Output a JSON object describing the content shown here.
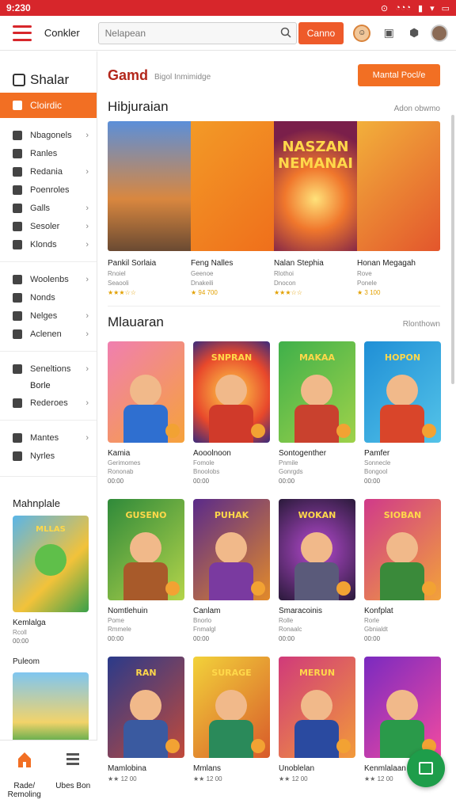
{
  "status": {
    "time": "9:230"
  },
  "appbar": {
    "brand": "Conkler",
    "search_placeholder": "Nelapean",
    "search_button": "Canno"
  },
  "sidebar": {
    "title": "Shalar",
    "active": "Cloirdic",
    "items": [
      {
        "label": "Nbagonels",
        "chevron": true
      },
      {
        "label": "Ranles",
        "chevron": false
      },
      {
        "label": "Redania",
        "chevron": true
      },
      {
        "label": "Poenroles",
        "chevron": false
      },
      {
        "label": "Galls",
        "chevron": true
      },
      {
        "label": "Sesoler",
        "chevron": true
      },
      {
        "label": "Klonds",
        "chevron": true
      }
    ],
    "items2": [
      {
        "label": "Woolenbs",
        "chevron": true
      },
      {
        "label": "Nonds",
        "chevron": false
      },
      {
        "label": "Nelges",
        "chevron": true
      },
      {
        "label": "Aclenen",
        "chevron": true
      }
    ],
    "items3": [
      {
        "label": "Seneltions",
        "chevron": true,
        "sub": "Borle"
      },
      {
        "label": "Rederoes",
        "chevron": true
      }
    ],
    "items4": [
      {
        "label": "Mantes",
        "chevron": true
      },
      {
        "label": "Nyrles",
        "chevron": false
      }
    ],
    "featured_title": "Mahnplale",
    "featured_card": {
      "title": "Kemlalga",
      "sub": "Rcoll",
      "meta": "00:00"
    },
    "featured2_title": "Puleom"
  },
  "bottomnav": [
    {
      "label": "Rade/ Remoling",
      "icon": "home-icon"
    },
    {
      "label": "Ubes Bon",
      "icon": "list-icon"
    }
  ],
  "main": {
    "title": "Gamd",
    "subtitle": "Bigol Inmimidge",
    "cta": "Mantal Pocl/e",
    "banner_section": {
      "title": "Hibjuraian",
      "more": "Adon obwmo"
    },
    "banner": [
      {
        "title": "Pankil Sorlaia",
        "sub": "Rnoiel",
        "meta": "Seaooli",
        "rating": "★★★☆☆",
        "bg": "linear-gradient(180deg,#5b8fd9 0%,#d9873f 60%,#6a4a32 100%)",
        "art": ""
      },
      {
        "title": "Feng Nalles",
        "sub": "Geenoe",
        "meta": "Dnakeili",
        "rating": "★ 94 700",
        "bg": "linear-gradient(135deg,#f39a27 0%,#ef6f1b 100%)",
        "art": ""
      },
      {
        "title": "Nalan Stephia",
        "sub": "Rlothoi",
        "meta": "Dnocon",
        "rating": "★★★☆☆",
        "bg": "radial-gradient(circle at 50% 60%,#ffe27a 0%,#f0772c 35%,#7a1f4a 80%)",
        "art": "NASZAN NEMANAI"
      },
      {
        "title": "Honan Megagah",
        "sub": "Rove",
        "meta": "Ponele",
        "rating": "★ 3 100",
        "bg": "linear-gradient(135deg,#f2b03b 0%,#e3562c 100%)",
        "art": ""
      }
    ],
    "grid_section": {
      "title": "Mlauaran",
      "more": "Rlonthown"
    },
    "rows": [
      [
        {
          "title": "Kamia",
          "sub": "Gerimomes",
          "meta": "Rononab",
          "stat": "00:00",
          "bg": "linear-gradient(135deg,#f07fb0,#f6a23a)",
          "art": "",
          "body": "#2f6fd0"
        },
        {
          "title": "Aooolnoon",
          "sub": "Fomole",
          "meta": "Bnoolobs",
          "stat": "00:00",
          "bg": "radial-gradient(circle at 50% 50%,#ffd24a,#e8482b 60%,#3a2b7c)",
          "art": "SNPRAN",
          "body": "#d03a2a"
        },
        {
          "title": "Sontogenther",
          "sub": "Pnmile",
          "meta": "Gonrgds",
          "stat": "00:00",
          "bg": "linear-gradient(135deg,#3fb04a,#9fd24a)",
          "art": "MAKAA",
          "body": "#c9412e"
        },
        {
          "title": "Pamfer",
          "sub": "Sonnecle",
          "meta": "Bongool",
          "stat": "00:00",
          "bg": "linear-gradient(135deg,#1f8fd6,#54c3e8)",
          "art": "HOPON",
          "body": "#d9452a"
        }
      ],
      [
        {
          "title": "Nomtlehuin",
          "sub": "Pome",
          "meta": "Rmmele",
          "stat": "00:00",
          "bg": "linear-gradient(135deg,#2f8a3a,#b4d44a)",
          "art": "GUSENO",
          "body": "#a85a2a"
        },
        {
          "title": "Canlam",
          "sub": "Bnorlo",
          "meta": "Fnmalgl",
          "stat": "00:00",
          "bg": "linear-gradient(135deg,#5a2a8a,#e28a2a)",
          "art": "PUHAK",
          "body": "#7a3aa0"
        },
        {
          "title": "Smaracoinis",
          "sub": "Rolle",
          "meta": "Ronaalc",
          "stat": "00:00",
          "bg": "radial-gradient(circle at 50% 50%,#b54ad0,#2a1a3a)",
          "art": "WOKAN",
          "body": "#5a5a7a"
        },
        {
          "title": "Konfplat",
          "sub": "Rorle",
          "meta": "Gbnialdt",
          "stat": "00:00",
          "bg": "linear-gradient(135deg,#d03a8a,#f2a23a)",
          "art": "SIOBAN",
          "body": "#3a8a3a"
        }
      ],
      [
        {
          "title": "Mamlobina",
          "sub": "",
          "meta": "",
          "stat": "★★ 12 00",
          "bg": "linear-gradient(135deg,#2a3a8a,#c24a3a)",
          "art": "RAN",
          "body": "#3a5aa0"
        },
        {
          "title": "Mmlans",
          "sub": "",
          "meta": "",
          "stat": "★★ 12 00",
          "bg": "linear-gradient(135deg,#f2d23a,#d85a2a)",
          "art": "SURAGE",
          "body": "#2a8a5a"
        },
        {
          "title": "Unoblelan",
          "sub": "",
          "meta": "",
          "stat": "★★ 12 00",
          "bg": "linear-gradient(135deg,#d03a7a,#f29a3a)",
          "art": "MERUN",
          "body": "#2a4aa0"
        },
        {
          "title": "Kenmlalaan",
          "sub": "",
          "meta": "",
          "stat": "★★ 12 00",
          "bg": "linear-gradient(135deg,#7a2ac0,#f24aa0)",
          "art": "",
          "body": "#2a9a4a"
        }
      ]
    ]
  }
}
